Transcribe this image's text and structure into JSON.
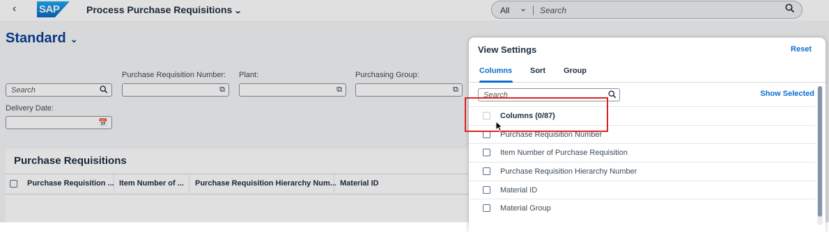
{
  "shell": {
    "back": "‹",
    "logo": "SAP",
    "app_title": "Process Purchase Requisitions",
    "search_scope": "All",
    "search_placeholder": "Search"
  },
  "variant": {
    "name": "Standard"
  },
  "filters": {
    "search_placeholder": "Search",
    "pr_number_label": "Purchase Requisition Number:",
    "plant_label": "Plant:",
    "purchasing_group_label": "Purchasing Group:",
    "delivery_date_label": "Delivery Date:"
  },
  "table": {
    "title": "Purchase Requisitions",
    "columns": [
      "Purchase Requisition ...",
      "Item Number of ...",
      "Purchase Requisition Hierarchy Num...",
      "Material ID"
    ]
  },
  "dialog": {
    "title": "View Settings",
    "reset": "Reset",
    "tabs": [
      "Columns",
      "Sort",
      "Group"
    ],
    "search_placeholder": "Search",
    "show_selected": "Show Selected",
    "columns_header": "Columns (0/87)",
    "items": [
      "Purchase Requisition Number",
      "Item Number of Purchase Requisition",
      "Purchase Requisition Hierarchy Number",
      "Material ID",
      "Material Group"
    ]
  },
  "colors": {
    "accent": "#0a6ed1",
    "highlight": "#e02020",
    "variant_title": "#0a3e94"
  }
}
